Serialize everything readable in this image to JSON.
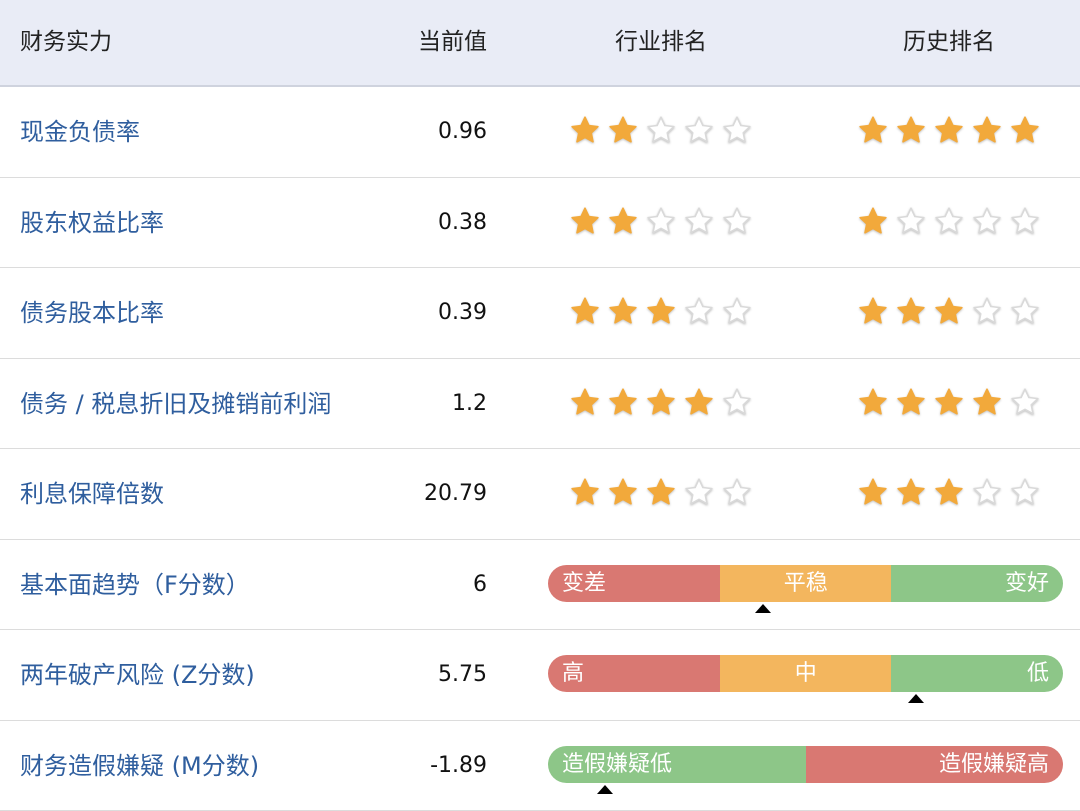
{
  "header": {
    "name": "财务实力",
    "value": "当前值",
    "industry_rank": "行业排名",
    "history_rank": "历史排名"
  },
  "colors": {
    "star_filled": "#f2a93b",
    "star_empty": "#d9d9d9",
    "link_text": "#2f5e9e",
    "bar_red": "#d97872",
    "bar_orange": "#f3b65e",
    "bar_green": "#8dc688"
  },
  "rows": [
    {
      "label": "现金负债率",
      "value": "0.96",
      "industry_stars": 2,
      "history_stars": 5
    },
    {
      "label": "股东权益比率",
      "value": "0.38",
      "industry_stars": 2,
      "history_stars": 1
    },
    {
      "label": "债务股本比率",
      "value": "0.39",
      "industry_stars": 3,
      "history_stars": 3
    },
    {
      "label": "债务 / 税息折旧及摊销前利润",
      "value": "1.2",
      "industry_stars": 4,
      "history_stars": 4
    },
    {
      "label": "利息保障倍数",
      "value": "20.79",
      "industry_stars": 3,
      "history_stars": 3
    }
  ],
  "bar_rows": [
    {
      "label": "基本面趋势（F分数）",
      "value": "6",
      "segments": [
        {
          "label": "变差",
          "color": "red",
          "align": "left",
          "fraction": 0.334
        },
        {
          "label": "平稳",
          "color": "orange",
          "align": "center",
          "fraction": 0.333
        },
        {
          "label": "变好",
          "color": "green",
          "align": "right",
          "fraction": 0.333
        }
      ],
      "marker_fraction": 0.417
    },
    {
      "label": "两年破产风险 (Z分数)",
      "value": "5.75",
      "segments": [
        {
          "label": "高",
          "color": "red",
          "align": "left",
          "fraction": 0.334
        },
        {
          "label": "中",
          "color": "orange",
          "align": "center",
          "fraction": 0.333
        },
        {
          "label": "低",
          "color": "green",
          "align": "right",
          "fraction": 0.333
        }
      ],
      "marker_fraction": 0.715
    },
    {
      "label": "财务造假嫌疑 (M分数)",
      "value": "-1.89",
      "segments": [
        {
          "label": "造假嫌疑低",
          "color": "green",
          "align": "left",
          "fraction": 0.5
        },
        {
          "label": "造假嫌疑高",
          "color": "red",
          "align": "right",
          "fraction": 0.5
        }
      ],
      "marker_fraction": 0.11
    }
  ]
}
